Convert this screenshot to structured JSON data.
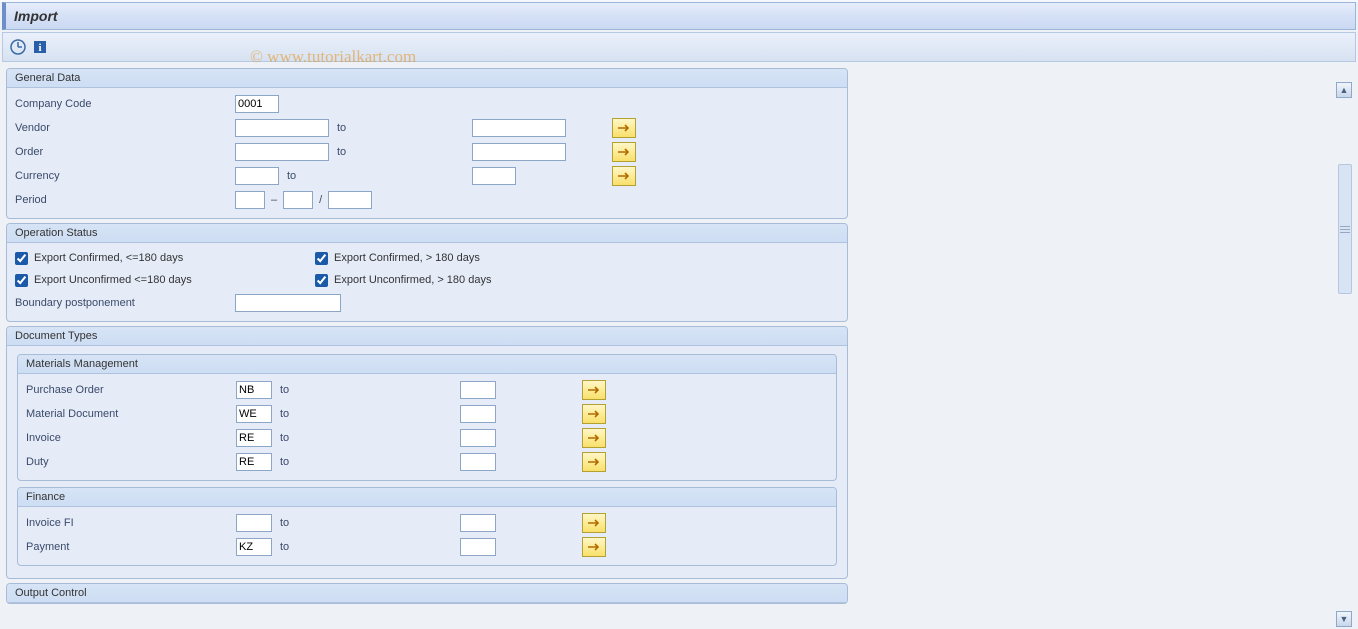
{
  "title": "Import",
  "watermark": "© www.tutorialkart.com",
  "groups": {
    "general": {
      "title": "General Data",
      "company_code_label": "Company Code",
      "company_code_value": "0001",
      "vendor_label": "Vendor",
      "order_label": "Order",
      "currency_label": "Currency",
      "period_label": "Period",
      "to": "to"
    },
    "opstat": {
      "title": "Operation Status",
      "conf_le": "Export Confirmed, <=180 days",
      "conf_gt": "Export Confirmed, > 180 days",
      "unconf_le": "Export Unconfirmed <=180 days",
      "unconf_gt": "Export Unconfirmed, > 180 days",
      "boundary_label": "Boundary postponement"
    },
    "doctypes": {
      "title": "Document Types",
      "mm": {
        "title": "Materials Management",
        "po_label": "Purchase Order",
        "po_value": "NB",
        "md_label": "Material Document",
        "md_value": "WE",
        "inv_label": "Invoice",
        "inv_value": "RE",
        "duty_label": "Duty",
        "duty_value": "RE"
      },
      "fin": {
        "title": "Finance",
        "invfi_label": "Invoice FI",
        "invfi_value": "",
        "pay_label": "Payment",
        "pay_value": "KZ"
      }
    },
    "output": {
      "title": "Output Control"
    }
  },
  "common": {
    "to": "to",
    "dash": "–",
    "slash": "/"
  }
}
